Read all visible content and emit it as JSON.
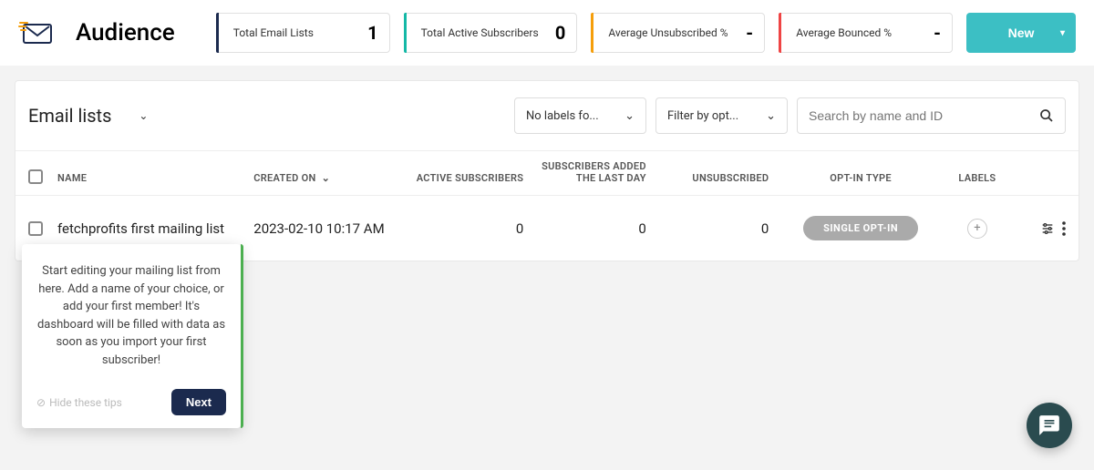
{
  "header": {
    "title": "Audience",
    "stats": [
      {
        "label": "Total Email Lists",
        "value": "1"
      },
      {
        "label": "Total Active Subscribers",
        "value": "0"
      },
      {
        "label": "Average Unsubscribed %",
        "value": "-"
      },
      {
        "label": "Average Bounced %",
        "value": "-"
      }
    ],
    "new_button": "New"
  },
  "panel": {
    "title": "Email lists",
    "label_filter": "No labels fo...",
    "optin_filter": "Filter by opt...",
    "search_placeholder": "Search by name and ID"
  },
  "table": {
    "headers": {
      "name": "NAME",
      "created": "CREATED ON",
      "active": "ACTIVE SUBSCRIBERS",
      "added": "SUBSCRIBERS ADDED THE LAST DAY",
      "unsub": "UNSUBSCRIBED",
      "optin": "OPT-IN TYPE",
      "labels": "LABELS"
    },
    "rows": [
      {
        "name": "fetchprofits first mailing list",
        "created": "2023-02-10 10:17 AM",
        "active": "0",
        "added": "0",
        "unsub": "0",
        "optin": "SINGLE OPT-IN"
      }
    ]
  },
  "tip": {
    "text": "Start editing your mailing list from here. Add a name of your choice, or add your first member! It's dashboard will be filled with data as soon as you import your first subscriber!",
    "hide": "Hide these tips",
    "next": "Next"
  }
}
